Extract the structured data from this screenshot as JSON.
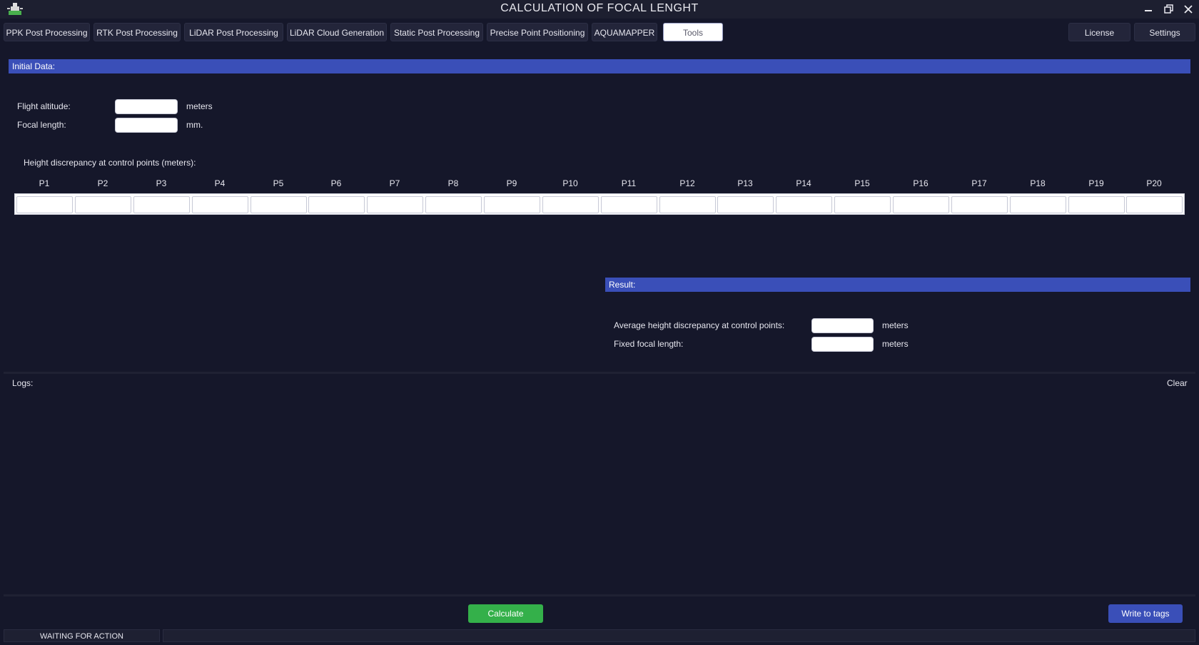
{
  "window": {
    "title": "CALCULATION OF FOCAL LENGHT",
    "controls": [
      "minimize-icon",
      "restore-icon",
      "close-icon"
    ]
  },
  "tabs": [
    {
      "label": "PPK Post Processing",
      "active": false
    },
    {
      "label": "RTK Post Processing",
      "active": false
    },
    {
      "label": "LiDAR Post Processing",
      "active": false
    },
    {
      "label": "LiDAR Cloud Generation",
      "active": false
    },
    {
      "label": "Static Post Processing",
      "active": false
    },
    {
      "label": "Precise Point Positioning",
      "active": false
    },
    {
      "label": "AQUAMAPPER",
      "active": false
    },
    {
      "label": "Tools",
      "active": true
    }
  ],
  "right_tabs": {
    "license": "License",
    "settings": "Settings"
  },
  "initial": {
    "header": "Initial Data:",
    "flight_altitude_label": "Flight altitude:",
    "flight_altitude_value": "",
    "flight_altitude_unit": "meters",
    "focal_length_label": "Focal length:",
    "focal_length_value": "",
    "focal_length_unit": "mm.",
    "discrepancy_label": "Height discrepancy at control points (meters):",
    "points": [
      "P1",
      "P2",
      "P3",
      "P4",
      "P5",
      "P6",
      "P7",
      "P8",
      "P9",
      "P10",
      "P11",
      "P12",
      "P13",
      "P14",
      "P15",
      "P16",
      "P17",
      "P18",
      "P19",
      "P20"
    ]
  },
  "result": {
    "header": "Result:",
    "avg_label": "Average height discrepancy at control points:",
    "avg_value": "",
    "avg_unit": "meters",
    "fixed_label": "Fixed focal length:",
    "fixed_value": "",
    "fixed_unit": "meters"
  },
  "logs": {
    "label": "Logs:",
    "clear": "Clear"
  },
  "actions": {
    "calculate": "Calculate",
    "write_tags": "Write to tags"
  },
  "status": {
    "text": "WAITING FOR ACTION",
    "secondary": ""
  },
  "colors": {
    "background": "#15172a",
    "header": "#3a4fb8",
    "calculate": "#34b04a",
    "write_tags": "#3a4fb8"
  }
}
